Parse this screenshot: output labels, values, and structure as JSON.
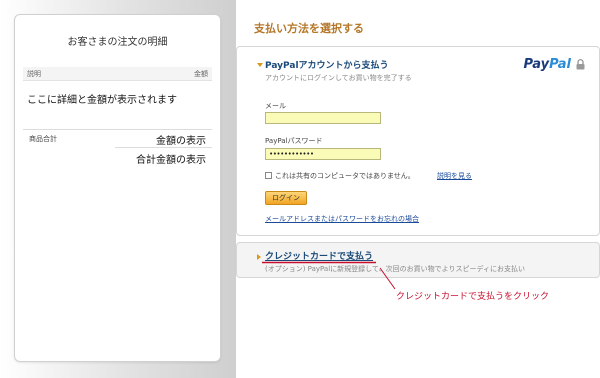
{
  "order": {
    "title": "お客さまの注文の明細",
    "col_description": "説明",
    "col_amount": "金額",
    "detail_text": "ここに詳細と金額が表示されます",
    "subtotal_label": "商品合計",
    "subtotal_value": "金額の表示",
    "total_value": "合計金額の表示"
  },
  "page": {
    "title": "支払い方法を選択する"
  },
  "paypal": {
    "heading": "PayPalアカウントから支払う",
    "subheading": "アカウントにログインしてお買い物を完了する",
    "logo_part1": "Pay",
    "logo_part2": "Pal",
    "email_label": "メール",
    "email_value": "",
    "password_label": "PayPalパスワード",
    "password_value": "••••••••••••",
    "remember_label": "これは共有のコンピュータではありません。",
    "remember_link": "説明を見る",
    "login_button": "ログイン",
    "forgot_link": "メールアドレスまたはパスワードをお忘れの場合"
  },
  "credit_card": {
    "heading": "クレジットカードで支払う",
    "subheading": "(オプション) PayPalに新規登録して、次回のお買い物でよりスピーディにお支払い"
  },
  "annotation": {
    "callout_text": "クレジットカードで支払うをクリック",
    "color": "#c8102e"
  },
  "colors": {
    "title_orange": "#b5782a",
    "link_blue": "#1a4a9a",
    "heading_blue": "#1a4a7a",
    "input_yellow": "#fbfbb8",
    "button_orange": "#f2a524"
  }
}
